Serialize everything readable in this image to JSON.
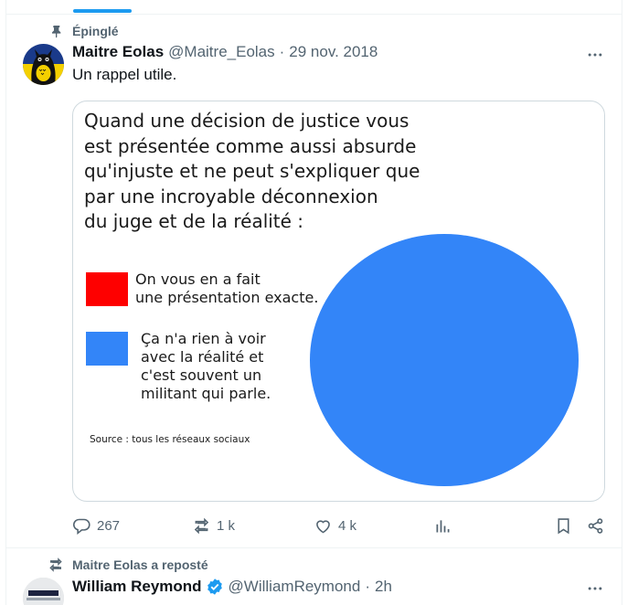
{
  "colors": {
    "accent": "#1d9bf0",
    "secondary_text": "#536471",
    "pie_blue": "#3385f8",
    "legend_red": "#fe0000"
  },
  "pinned": {
    "icon": "pin-icon",
    "label": "Épinglé"
  },
  "tweet": {
    "author_name": "Maitre Eolas",
    "handle": "@Maitre_Eolas",
    "separator": "·",
    "date": "29 nov. 2018",
    "text": "Un rappel utile.",
    "image": {
      "title_lines": [
        "Quand une décision de justice vous",
        "est présentée comme aussi absurde",
        "qu'injuste et ne peut s'expliquer que",
        "par une incroyable déconnexion",
        "du juge et de la réalité :"
      ],
      "legend": [
        {
          "color": "#fe0000",
          "lines": [
            "On vous en a fait",
            "une présentation exacte."
          ]
        },
        {
          "color": "#3385f8",
          "lines": [
            "Ça n'a rien à voir",
            "avec la réalité et",
            "c'est souvent un",
            "militant qui parle."
          ]
        }
      ],
      "source": "Source : tous les réseaux sociaux"
    },
    "actions": {
      "replies": "267",
      "reposts": "1 k",
      "likes": "4 k"
    }
  },
  "chart_data": {
    "type": "pie",
    "title": "Quand une décision de justice vous est présentée comme aussi absurde qu'injuste et ne peut s'expliquer que par une incroyable déconnexion du juge et de la réalité :",
    "categories": [
      "On vous en a fait une présentation exacte.",
      "Ça n'a rien à voir avec la réalité et c'est souvent un militant qui parle."
    ],
    "values": [
      0,
      100
    ],
    "colors": [
      "#fe0000",
      "#3385f8"
    ],
    "legend": "left",
    "annotation": "Source : tous les réseaux sociaux"
  },
  "repost": {
    "icon": "repost-icon",
    "label": "Maitre Eolas a reposté",
    "author_name": "William Reymond",
    "handle": "@WilliamReymond",
    "separator": "·",
    "time": "2h"
  }
}
